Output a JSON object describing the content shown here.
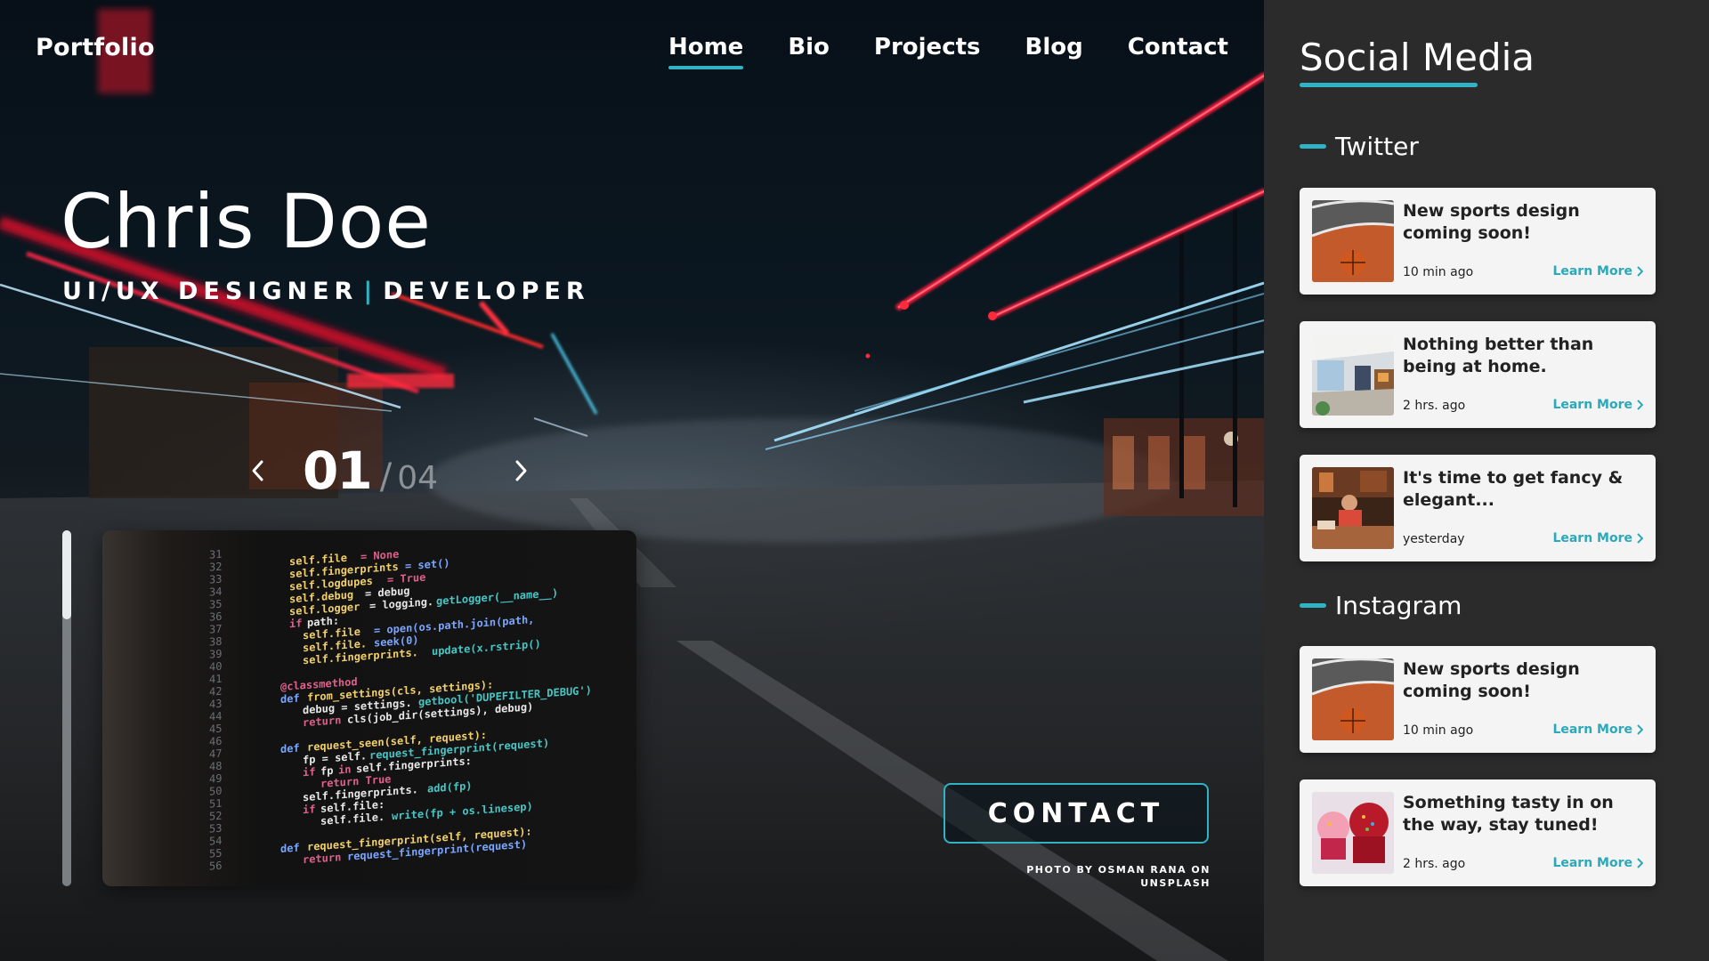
{
  "hero": {
    "logo": "Portfolio",
    "nav": [
      {
        "label": "Home",
        "active": true
      },
      {
        "label": "Bio",
        "active": false
      },
      {
        "label": "Projects",
        "active": false
      },
      {
        "label": "Blog",
        "active": false
      },
      {
        "label": "Contact",
        "active": false
      }
    ],
    "name": "Chris Doe",
    "role_left": "UI/UX DESIGNER",
    "role_sep": "|",
    "role_right": "DEVELOPER",
    "slider": {
      "current": "01",
      "separator": "/",
      "total": "04",
      "prev_icon": "chevron-left-icon",
      "next_icon": "chevron-right-icon",
      "progress_fraction": 0.25
    },
    "contact_button": "CONTACT",
    "photo_credit": "PHOTO BY OSMAN RANA ON UNSPLASH"
  },
  "sidebar": {
    "title": "Social Media",
    "sections": [
      {
        "label": "Twitter",
        "posts": [
          {
            "text": "New sports design coming soon!",
            "time": "10 min ago",
            "link": "Learn More",
            "thumb": "basketball"
          },
          {
            "text": "Nothing better than being at home.",
            "time": "2 hrs. ago",
            "link": "Learn More",
            "thumb": "room"
          },
          {
            "text": "It's time to get fancy & elegant...",
            "time": "yesterday",
            "link": "Learn More",
            "thumb": "restaurant"
          }
        ]
      },
      {
        "label": "Instagram",
        "posts": [
          {
            "text": "New sports design coming soon!",
            "time": "10 min ago",
            "link": "Learn More",
            "thumb": "basketball"
          },
          {
            "text": "Something tasty in on the way, stay tuned!",
            "time": "2 hrs. ago",
            "link": "Learn More",
            "thumb": "cupcakes"
          }
        ]
      }
    ]
  },
  "colors": {
    "accent": "#2fb3c5",
    "sidebar_bg": "#2b2b2c",
    "card_bg": "#f4f4f4"
  }
}
